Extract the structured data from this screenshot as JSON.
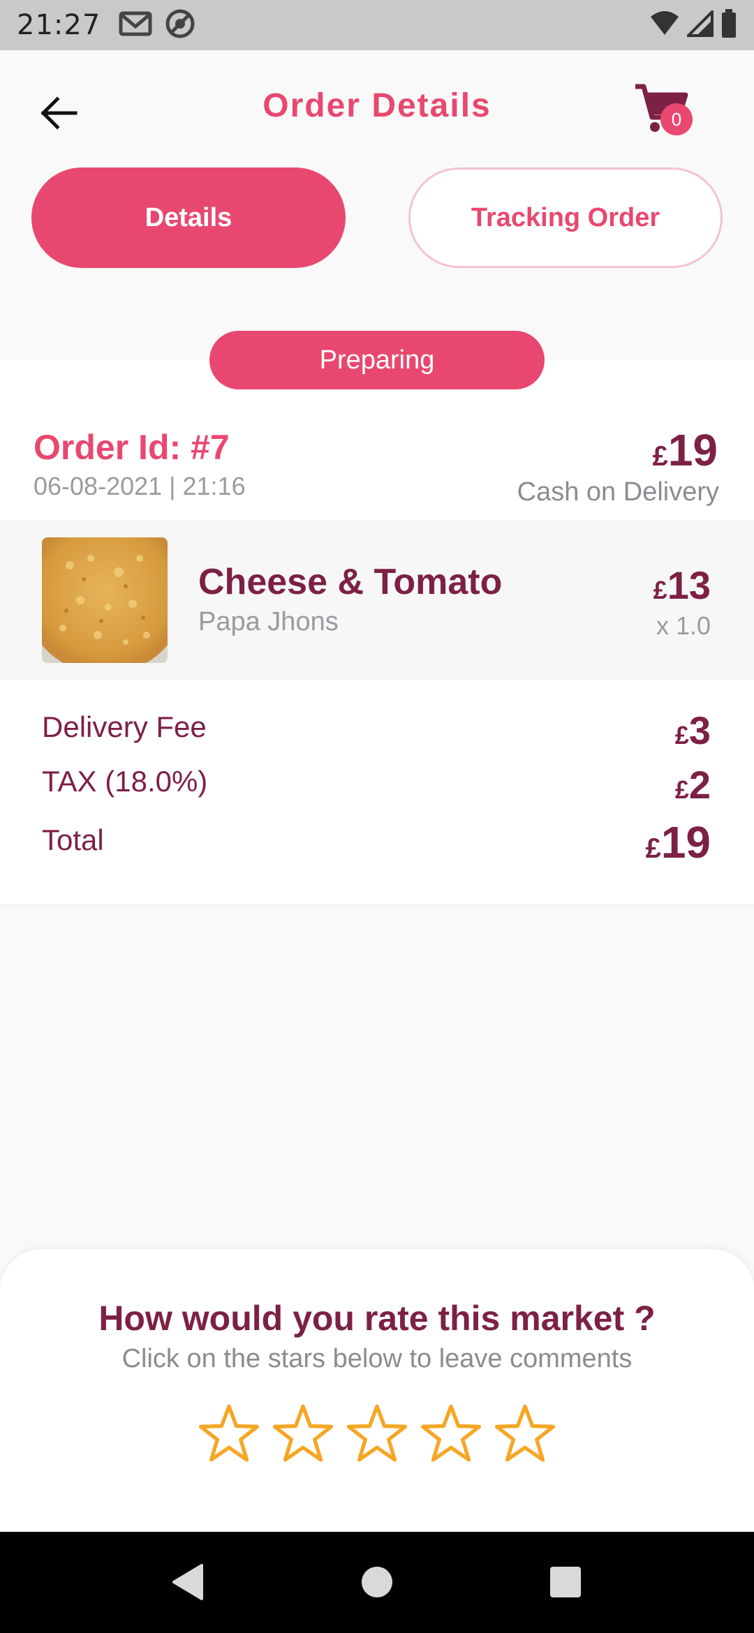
{
  "status_bar": {
    "time": "21:27",
    "left_icons": [
      "gmail-icon",
      "no-disturb-icon"
    ],
    "right_icons": [
      "wifi-icon",
      "signal-icon",
      "battery-icon"
    ]
  },
  "app_bar": {
    "title": "Order Details",
    "cart_count": "0"
  },
  "tabs": [
    {
      "label": "Details",
      "active": true
    },
    {
      "label": "Tracking Order",
      "active": false
    }
  ],
  "order": {
    "status": "Preparing",
    "id_label": "Order Id: #7",
    "datetime": "06-08-2021 | 21:16",
    "currency": "£",
    "total": "19",
    "payment_method": "Cash on Delivery",
    "item": {
      "name": "Cheese & Tomato",
      "vendor": "Papa Jhons",
      "price": "13",
      "quantity": "x 1.0"
    },
    "summary": [
      {
        "label": "Delivery Fee",
        "value": "3"
      },
      {
        "label": "TAX (18.0%)",
        "value": "2"
      },
      {
        "label": "Total",
        "value": "19"
      }
    ]
  },
  "rating": {
    "title": "How would you rate this market ?",
    "subtitle": "Click on the stars below to leave comments",
    "stars_total": 5,
    "stars_selected": 0
  },
  "colors": {
    "accent": "#e8486f",
    "dark_text": "#7d2045",
    "star": "#f5a623"
  }
}
